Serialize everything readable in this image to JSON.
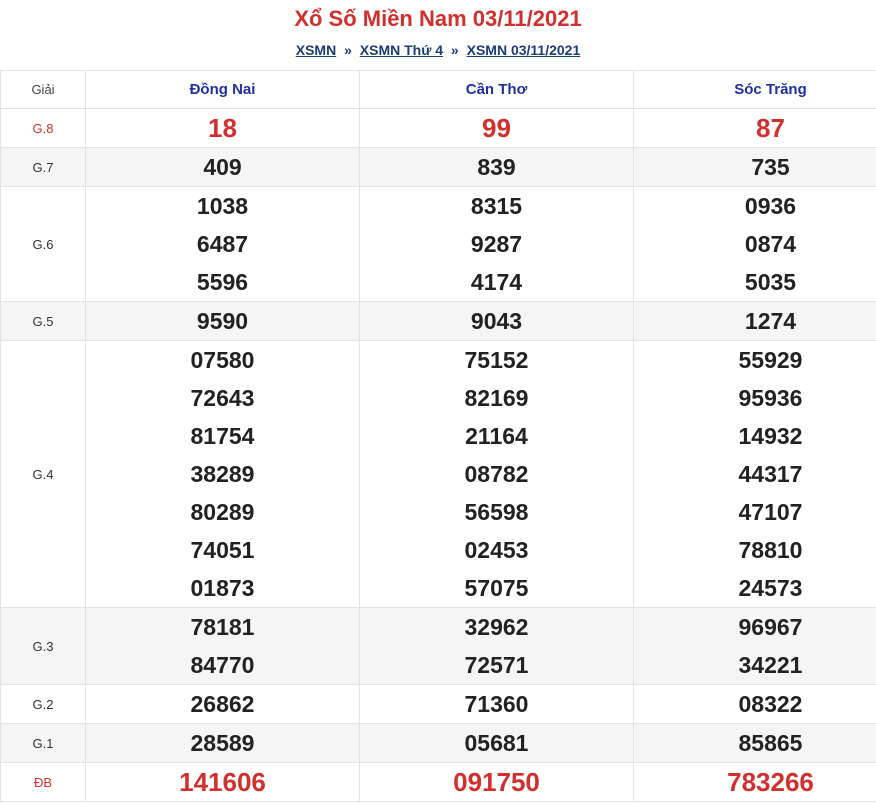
{
  "header": {
    "title": "Xổ Số Miền Nam 03/11/2021",
    "breadcrumb": [
      {
        "label": "XSMN"
      },
      {
        "label": "XSMN Thứ 4"
      },
      {
        "label": "XSMN 03/11/2021"
      }
    ],
    "separator": "»"
  },
  "table": {
    "label_header": "Giải",
    "provinces": [
      "Đồng Nai",
      "Cần Thơ",
      "Sóc Trăng"
    ],
    "rows": [
      {
        "label": "G.8",
        "red": true,
        "values": [
          [
            "18"
          ],
          [
            "99"
          ],
          [
            "87"
          ]
        ]
      },
      {
        "label": "G.7",
        "red": false,
        "values": [
          [
            "409"
          ],
          [
            "839"
          ],
          [
            "735"
          ]
        ]
      },
      {
        "label": "G.6",
        "red": false,
        "values": [
          [
            "1038",
            "6487",
            "5596"
          ],
          [
            "8315",
            "9287",
            "4174"
          ],
          [
            "0936",
            "0874",
            "5035"
          ]
        ]
      },
      {
        "label": "G.5",
        "red": false,
        "values": [
          [
            "9590"
          ],
          [
            "9043"
          ],
          [
            "1274"
          ]
        ]
      },
      {
        "label": "G.4",
        "red": false,
        "values": [
          [
            "07580",
            "72643",
            "81754",
            "38289",
            "80289",
            "74051",
            "01873"
          ],
          [
            "75152",
            "82169",
            "21164",
            "08782",
            "56598",
            "02453",
            "57075"
          ],
          [
            "55929",
            "95936",
            "14932",
            "44317",
            "47107",
            "78810",
            "24573"
          ]
        ]
      },
      {
        "label": "G.3",
        "red": false,
        "values": [
          [
            "78181",
            "84770"
          ],
          [
            "32962",
            "72571"
          ],
          [
            "96967",
            "34221"
          ]
        ]
      },
      {
        "label": "G.2",
        "red": false,
        "values": [
          [
            "26862"
          ],
          [
            "71360"
          ],
          [
            "08322"
          ]
        ]
      },
      {
        "label": "G.1",
        "red": false,
        "values": [
          [
            "28589"
          ],
          [
            "05681"
          ],
          [
            "85865"
          ]
        ]
      },
      {
        "label": "ĐB",
        "red": true,
        "values": [
          [
            "141606"
          ],
          [
            "091750"
          ],
          [
            "783266"
          ]
        ]
      }
    ]
  },
  "colors": {
    "accent_red": "#d32f2f",
    "link_blue": "#1a3d7c",
    "header_blue": "#1e2fa8"
  }
}
